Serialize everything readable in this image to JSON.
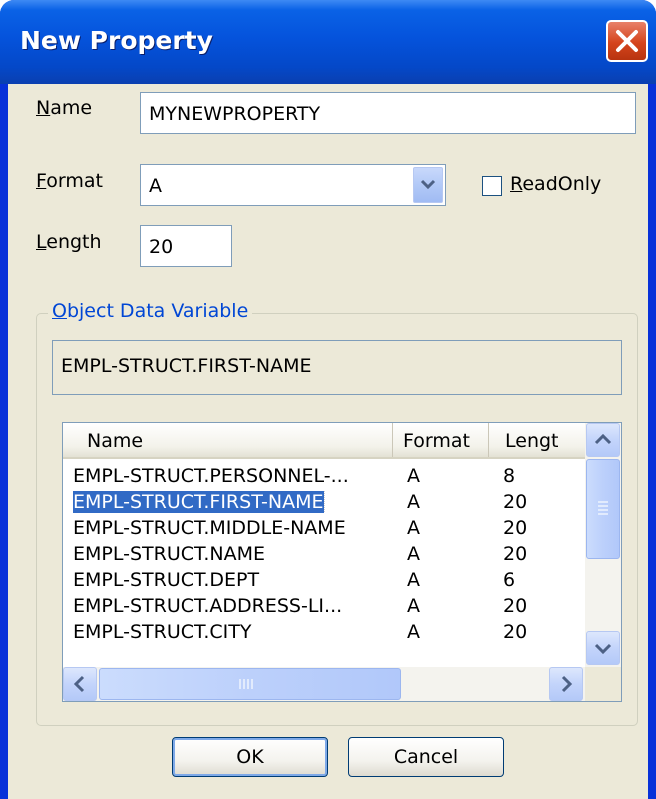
{
  "window": {
    "title": "New Property"
  },
  "form": {
    "name_label_u": "N",
    "name_label_rest": "ame",
    "name_value": "MYNEWPROPERTY",
    "format_label_u": "F",
    "format_label_rest": "ormat",
    "format_value": "A",
    "readonly_label_u": "R",
    "readonly_label_rest": "eadOnly",
    "readonly_checked": false,
    "length_label_u": "L",
    "length_label_rest": "ength",
    "length_value": "20"
  },
  "group": {
    "title_u": "O",
    "title_rest": "bject Data Variable",
    "selected_variable": "EMPL-STRUCT.FIRST-NAME"
  },
  "listview": {
    "columns": [
      "Name",
      "Format",
      "Lengt"
    ],
    "rows": [
      {
        "name": "EMPL-STRUCT.PERSONNEL-...",
        "format": "A",
        "length": "8",
        "selected": false
      },
      {
        "name": "EMPL-STRUCT.FIRST-NAME",
        "format": "A",
        "length": "20",
        "selected": true
      },
      {
        "name": "EMPL-STRUCT.MIDDLE-NAME",
        "format": "A",
        "length": "20",
        "selected": false
      },
      {
        "name": "EMPL-STRUCT.NAME",
        "format": "A",
        "length": "20",
        "selected": false
      },
      {
        "name": "EMPL-STRUCT.DEPT",
        "format": "A",
        "length": "6",
        "selected": false
      },
      {
        "name": "EMPL-STRUCT.ADDRESS-LI...",
        "format": "A",
        "length": "20",
        "selected": false
      },
      {
        "name": "EMPL-STRUCT.CITY",
        "format": "A",
        "length": "20",
        "selected": false
      }
    ]
  },
  "buttons": {
    "ok": "OK",
    "cancel": "Cancel"
  },
  "colors": {
    "titlebar": "#0553dc",
    "client_bg": "#ece9d8",
    "selection": "#316ac5",
    "group_title": "#0046d5"
  }
}
